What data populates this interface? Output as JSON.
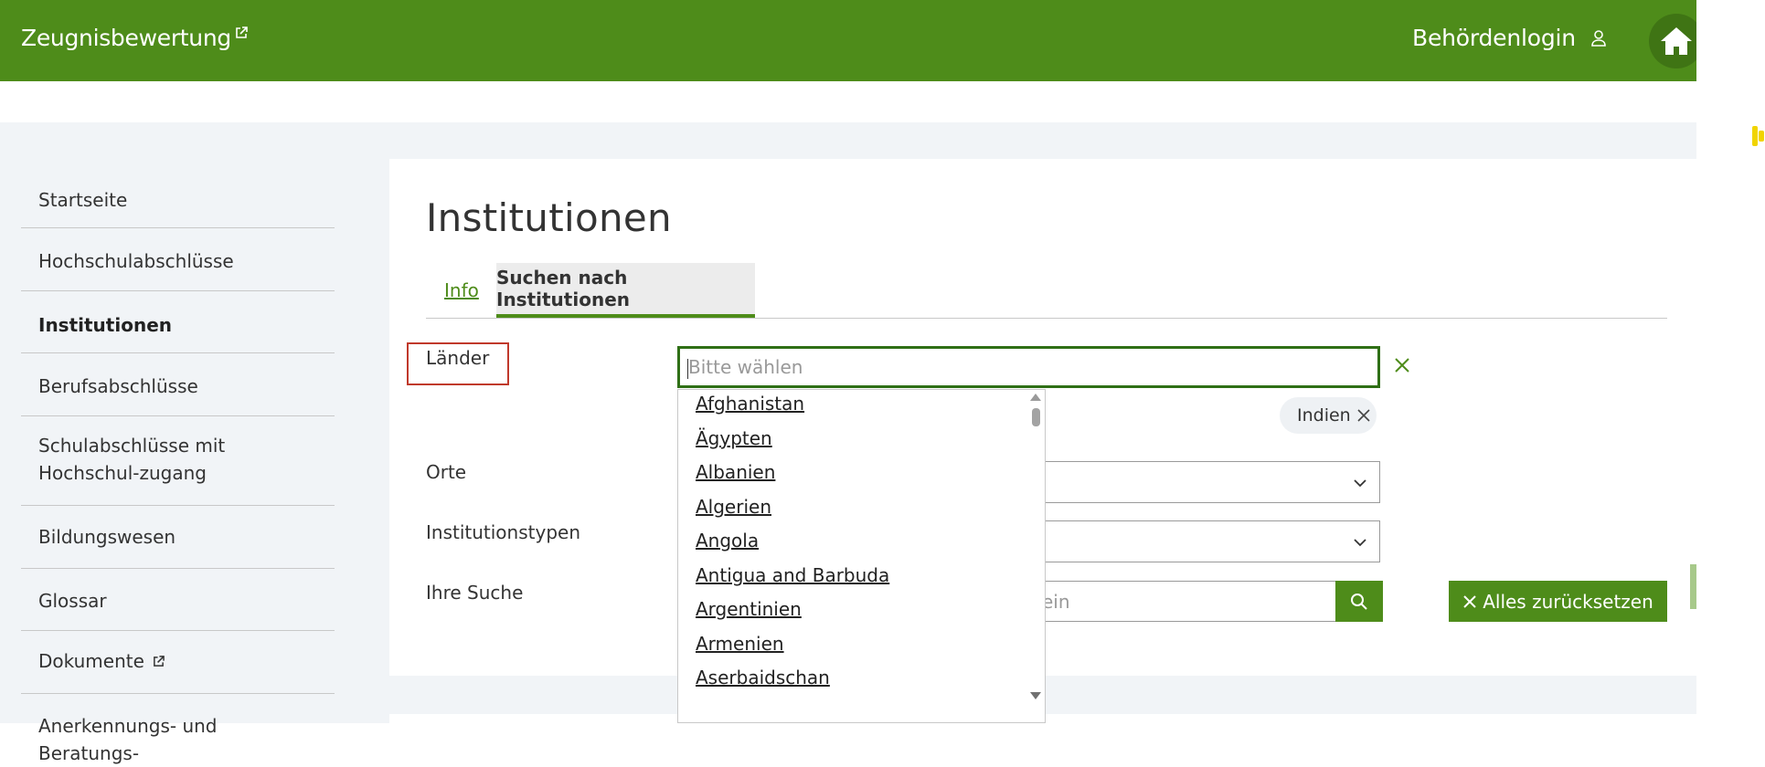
{
  "header": {
    "brand": "Zeugnisbewertung",
    "login": "Behördenlogin"
  },
  "sidebar": {
    "items": [
      {
        "label": "Startseite"
      },
      {
        "label": "Hochschulabschlüsse"
      },
      {
        "label": "Institutionen"
      },
      {
        "label": "Berufsabschlüsse"
      },
      {
        "label": "Schulabschlüsse mit Hochschul-zugang"
      },
      {
        "label": "Bildungswesen"
      },
      {
        "label": "Glossar"
      },
      {
        "label": "Dokumente"
      },
      {
        "label": "Anerkennungs- und Beratungs-"
      }
    ]
  },
  "main": {
    "title": "Institutionen",
    "tabs": [
      {
        "label": "Info"
      },
      {
        "label": "Suchen nach Institutionen"
      }
    ],
    "form": {
      "laender_label": "Länder",
      "laender_placeholder": "Bitte wählen",
      "selected_chip": "Indien",
      "orte_label": "Orte",
      "institutionstypen_label": "Institutionstypen",
      "ihre_suche_label": "Ihre Suche",
      "search_placeholder_fragment": "ein",
      "reset_label": "Alles zurücksetzen"
    },
    "dropdown_options": [
      "Afghanistan",
      "Ägypten",
      "Albanien",
      "Algerien",
      "Angola",
      "Antigua and Barbuda",
      "Argentinien",
      "Armenien",
      "Aserbaidschan"
    ]
  },
  "colors": {
    "brand_green": "#4e8c1a",
    "focus_green": "#2f6f16",
    "highlight_red": "#c0392b"
  }
}
